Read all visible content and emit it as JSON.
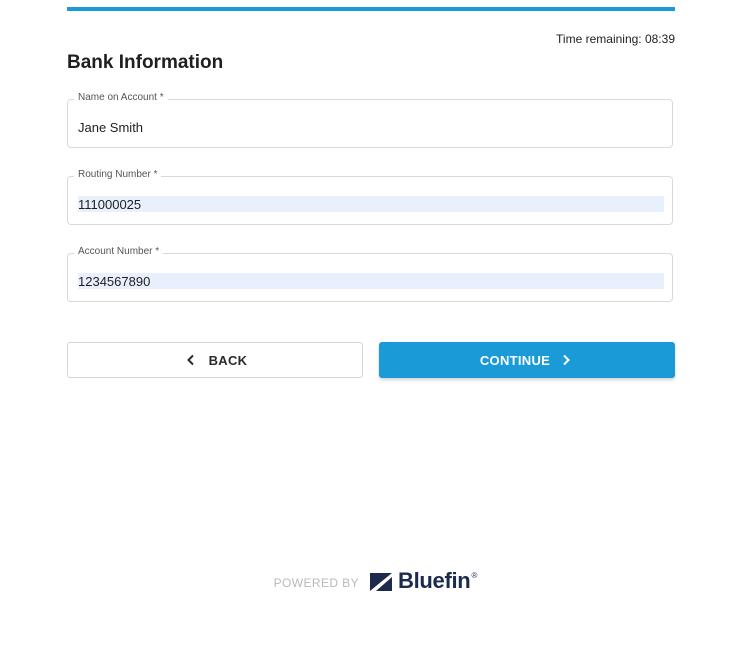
{
  "progress": {
    "fraction": 1.0,
    "color": "#1a9ad6"
  },
  "timer": {
    "text": "Time remaining: 08:39"
  },
  "form": {
    "title": "Bank Information",
    "fields": [
      {
        "label": "Name on Account *",
        "value": "Jane Smith",
        "autofilled": false
      },
      {
        "label": "Routing Number *",
        "value": "111000025",
        "autofilled": true
      },
      {
        "label": "Account Number *",
        "value": "1234567890",
        "autofilled": true
      }
    ]
  },
  "buttons": {
    "back_label": "BACK",
    "continue_label": "CONTINUE",
    "back_icon": "chevron-left-icon",
    "continue_icon": "chevron-right-icon"
  },
  "footer": {
    "powered_by": "POWERED BY",
    "brand": "Bluefin",
    "brand_mark": "®",
    "brand_color": "#1c2a4e"
  },
  "colors": {
    "accent": "#1a9ad6",
    "autofill_bg": "#e8f0fe"
  }
}
